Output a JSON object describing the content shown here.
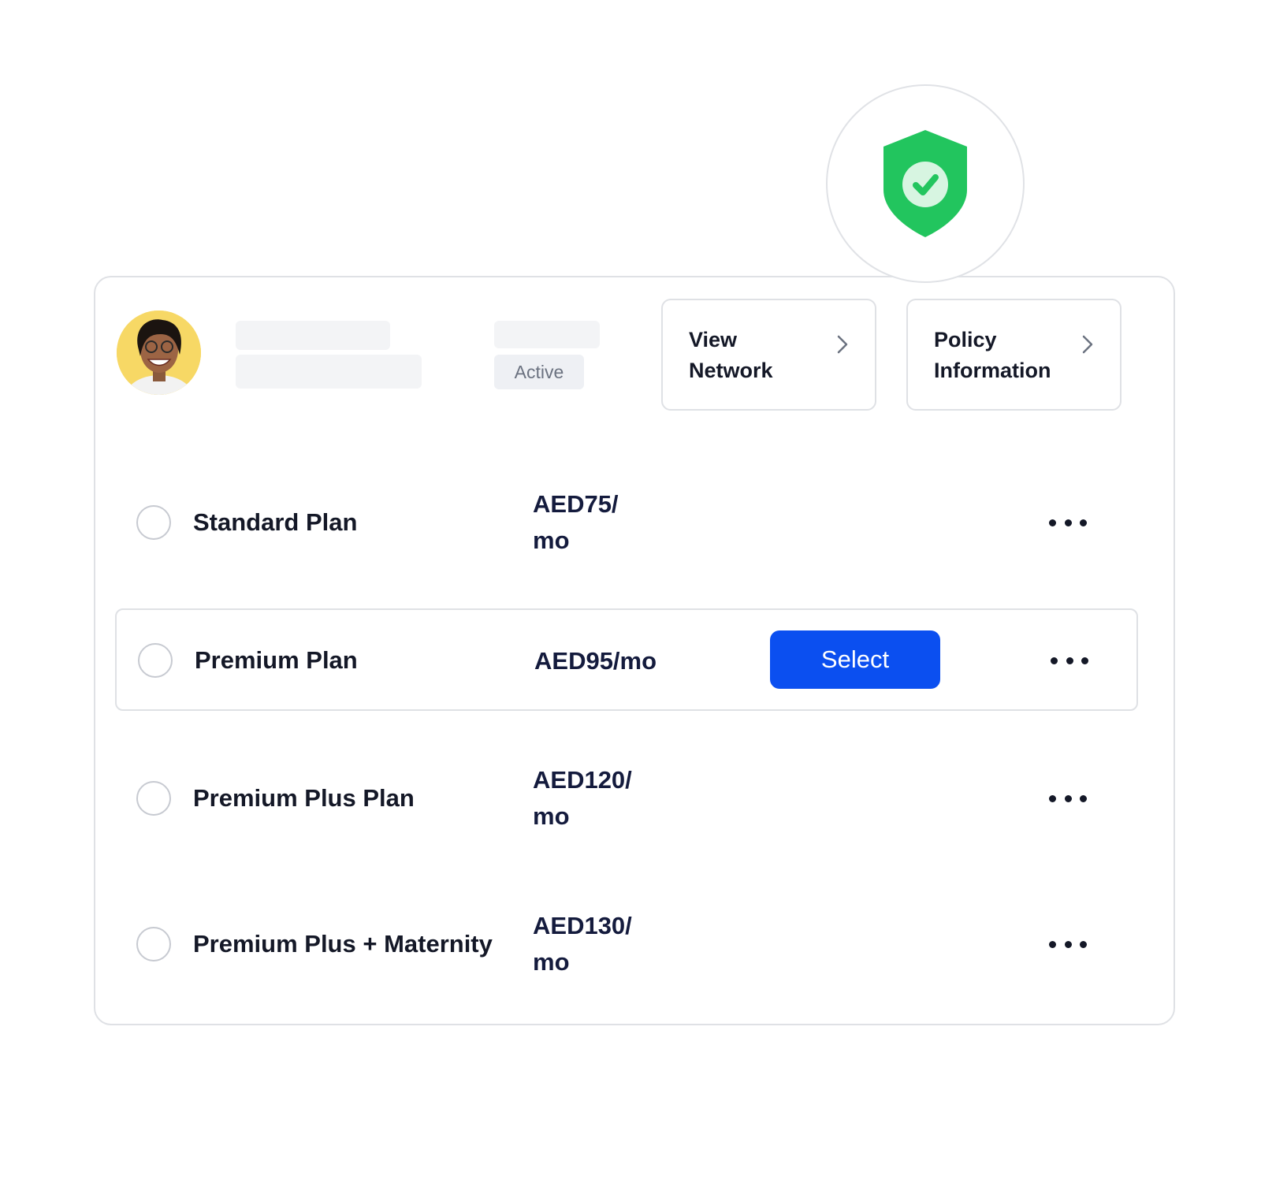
{
  "header": {
    "status": "Active",
    "links": [
      {
        "label_line1": "View",
        "label_line2": "Network",
        "icon": "chevron-right-icon"
      },
      {
        "label_line1": "Policy",
        "label_line2": "Information",
        "icon": "chevron-right-icon"
      }
    ]
  },
  "badge": {
    "icon": "shield-check-icon",
    "color": "#22c55e"
  },
  "plans": [
    {
      "name": "Standard Plan",
      "price_line1": "AED75/",
      "price_line2": "mo",
      "selected": false
    },
    {
      "name": "Premium Plan",
      "price": "AED95/mo",
      "selected": true,
      "action_label": "Select"
    },
    {
      "name": "Premium Plus Plan",
      "price_line1": "AED120/",
      "price_line2": "mo",
      "selected": false
    },
    {
      "name": "Premium Plus + Maternity",
      "price_line1": "AED130/",
      "price_line2": "mo",
      "selected": false
    }
  ],
  "colors": {
    "accent": "#0b4ff0",
    "border": "#dfe1e5",
    "shield": "#22c55e",
    "avatar_bg": "#f7d865"
  }
}
